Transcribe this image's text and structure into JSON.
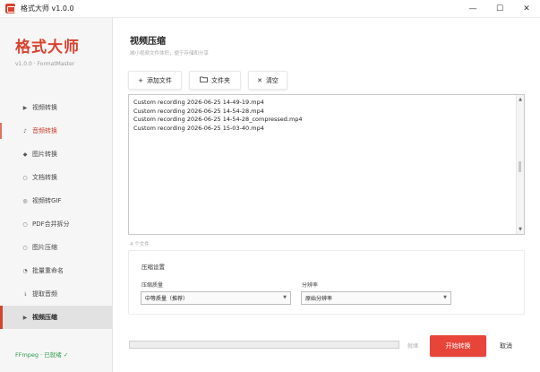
{
  "window": {
    "title": "格式大师 v1.0.0",
    "controls": [
      "—",
      "☐",
      "✕"
    ]
  },
  "sidebar": {
    "brand": "格式大师",
    "version": "v1.0.0 · FormatMaster",
    "items": [
      {
        "icon": "▶",
        "label": "视频转换",
        "icon_name": "play-icon"
      },
      {
        "icon": "♪",
        "label": "音频转换",
        "icon_name": "music-note-icon"
      },
      {
        "icon": "◆",
        "label": "图片转换",
        "icon_name": "image-icon"
      },
      {
        "icon": "○",
        "label": "文档转换",
        "icon_name": "document-icon"
      },
      {
        "icon": "◎",
        "label": "视频转GIF",
        "icon_name": "gif-icon"
      },
      {
        "icon": "○",
        "label": "PDF合并拆分",
        "icon_name": "pdf-icon"
      },
      {
        "icon": "○",
        "label": "图片压缩",
        "icon_name": "compress-image-icon"
      },
      {
        "icon": "◔",
        "label": "批量重命名",
        "icon_name": "rename-icon"
      },
      {
        "icon": "⇂",
        "label": "提取音频",
        "icon_name": "extract-audio-icon"
      },
      {
        "icon": "▶",
        "label": "视频压缩",
        "icon_name": "video-compress-icon"
      }
    ],
    "hover_index": 1,
    "active_index": 9,
    "ffmpeg_status": "FFmpeg · 已就绪 ✓"
  },
  "main": {
    "title": "视频压缩",
    "subtitle": "减小视频文件体积，便于存储和分享",
    "toolbar": {
      "add_files": "添加文件",
      "add_folder": "文件夹",
      "clear": "清空"
    },
    "files": [
      "Custom recording 2026-06-25 14-49-19.mp4",
      "Custom recording 2026-06-25 14-54-28.mp4",
      "Custom recording 2026-06-25 14-54-28_compressed.mp4",
      "Custom recording 2026-06-25 15-03-40.mp4"
    ],
    "file_count": "4 个文件",
    "settings": {
      "title": "压缩设置",
      "quality_label": "压缩质量",
      "quality_value": "中等质量（推荐）",
      "resolution_label": "分辨率",
      "resolution_value": "原始分辨率"
    },
    "progress": {
      "value": 0,
      "label": "就绪"
    },
    "start_label": "开始转换",
    "cancel_label": "取消"
  },
  "colors": {
    "accent": "#d8432f",
    "start_button": "#e8453a",
    "ready_green": "#2e9a4c"
  }
}
